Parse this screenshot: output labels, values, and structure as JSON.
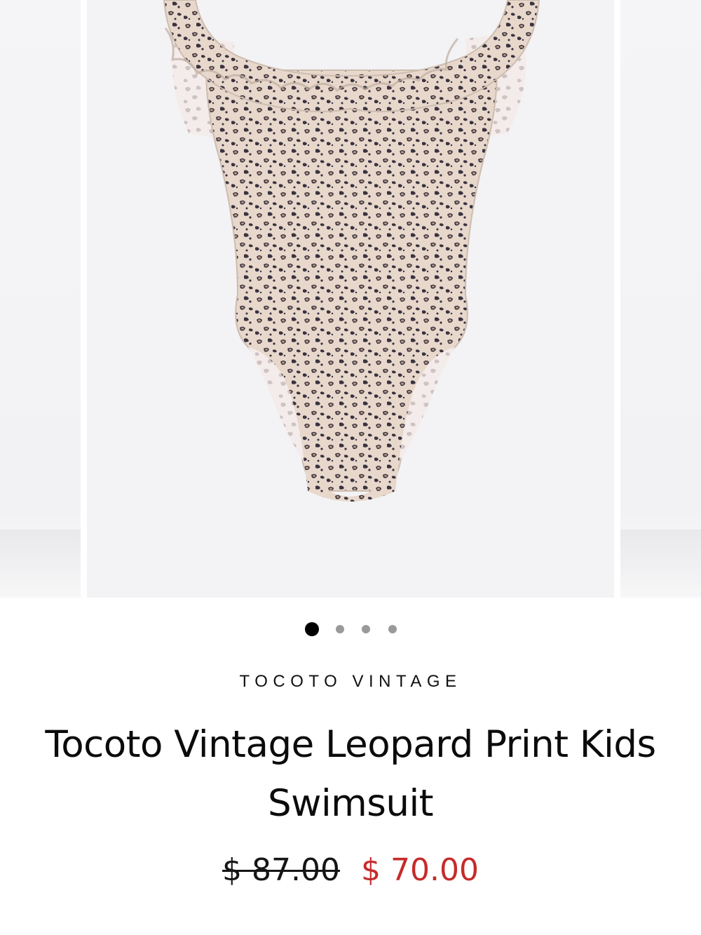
{
  "carousel": {
    "total_slides": 4,
    "active_index": 0,
    "dot_active_color": "#000000",
    "dot_inactive_color": "#9a9a9a"
  },
  "product": {
    "vendor": "TOCOTO VINTAGE",
    "title": "Tocoto Vintage Leopard Print Kids Swimsuit",
    "compare_at_price": "$ 87.00",
    "price": "$ 70.00",
    "sale_color": "#c62b2b"
  }
}
